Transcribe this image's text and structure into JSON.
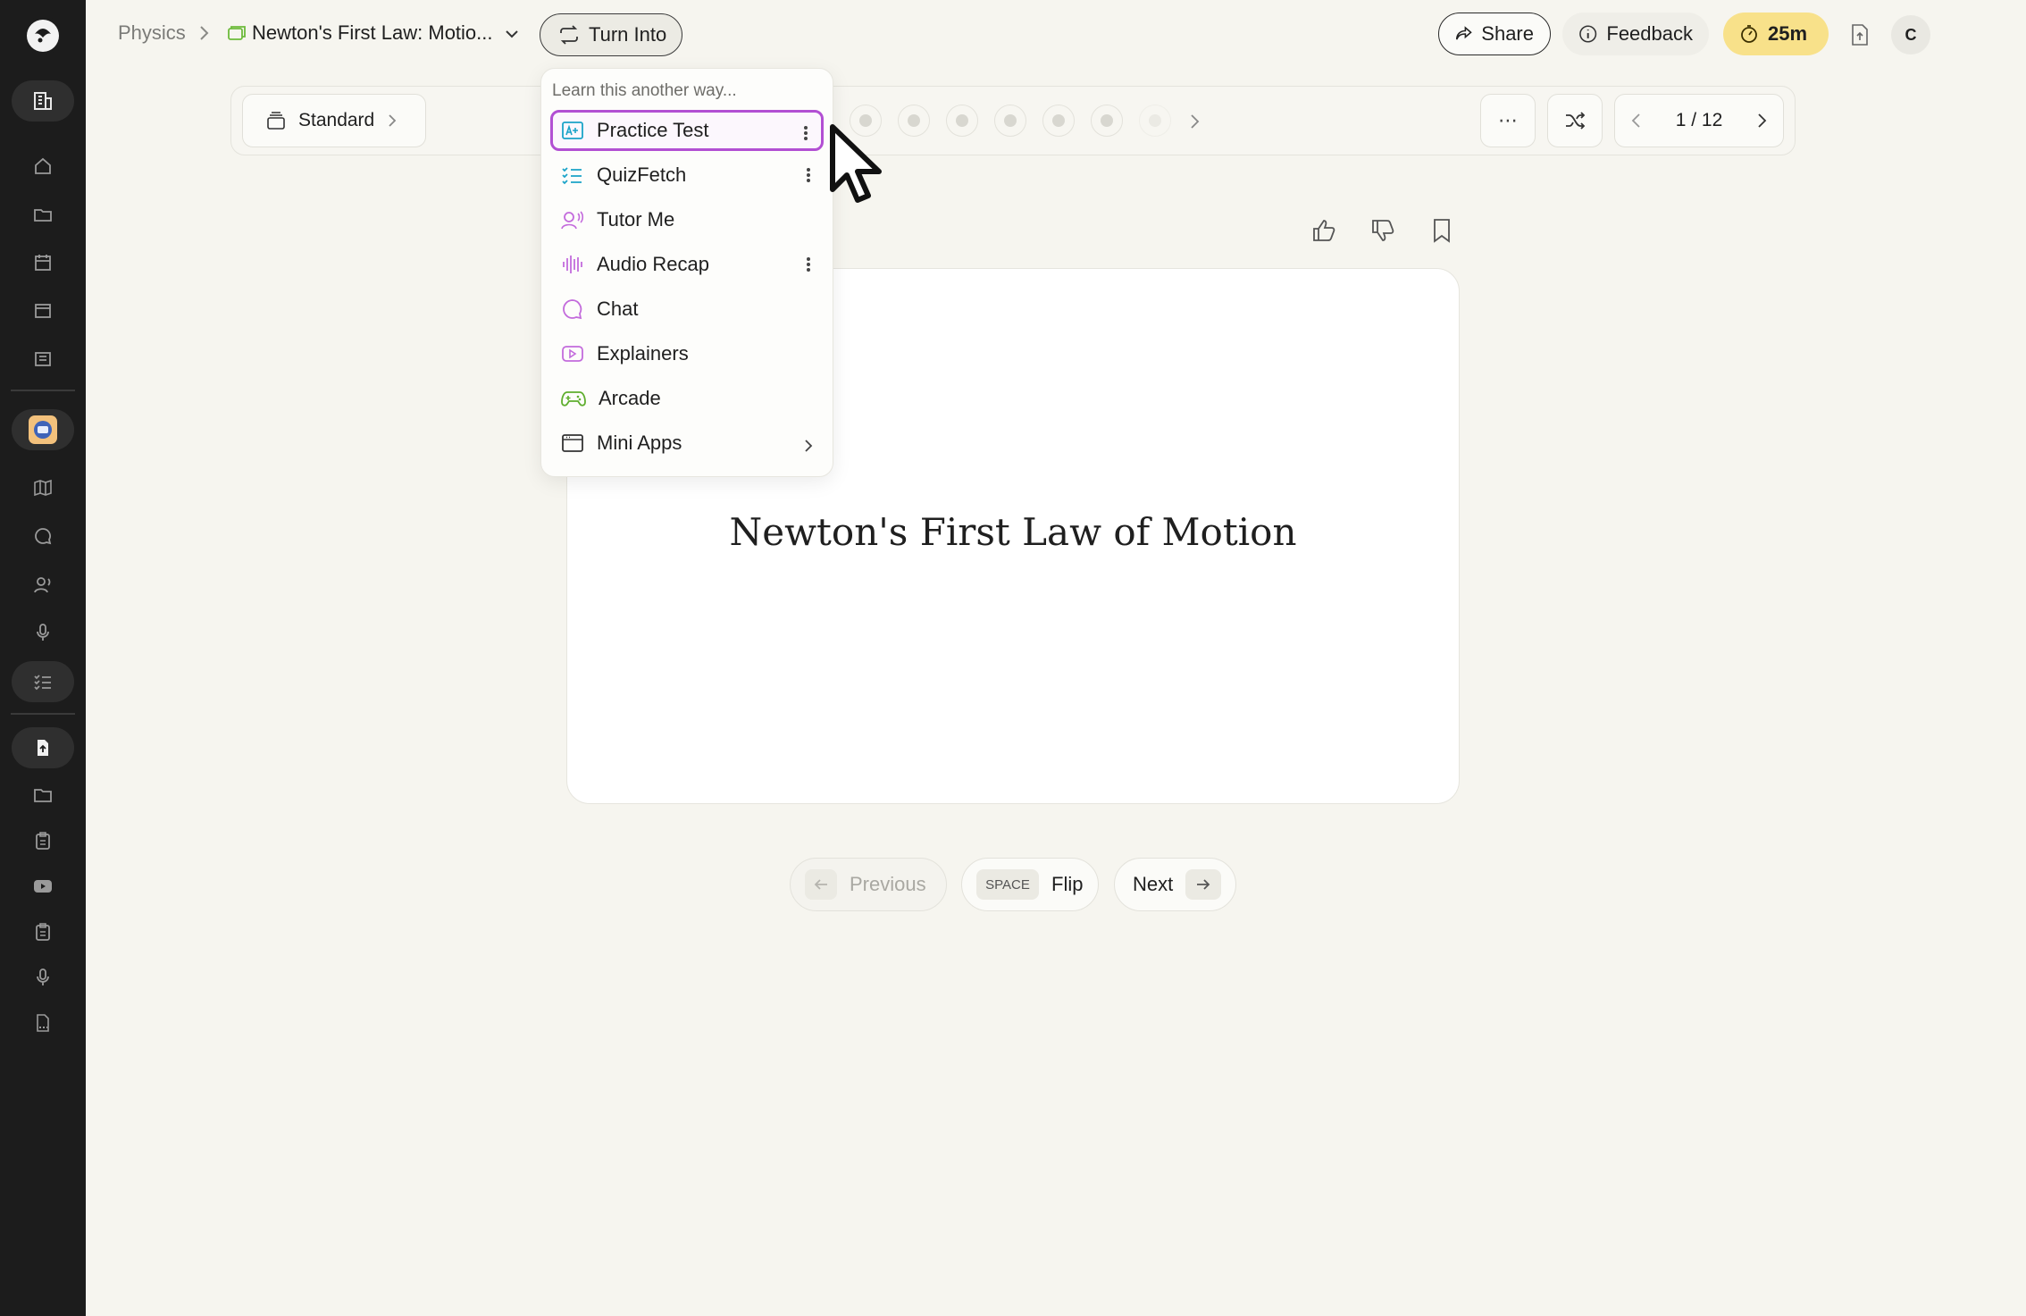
{
  "breadcrumb": {
    "parent": "Physics",
    "title": "Newton's First Law: Motio..."
  },
  "topbar": {
    "turn_into": "Turn Into",
    "share": "Share",
    "feedback": "Feedback",
    "timer": "25m",
    "avatar_initial": "C"
  },
  "toolbar": {
    "mode": "Standard",
    "more": "⋯",
    "pager": "1 / 12"
  },
  "card": {
    "front_text": "Newton's First Law of Motion"
  },
  "nav": {
    "previous": "Previous",
    "flip_key": "SPACE",
    "flip": "Flip",
    "next": "Next"
  },
  "dropdown": {
    "header": "Learn this another way...",
    "items": [
      {
        "label": "Practice Test",
        "icon": "practice-test-icon",
        "color": "#1aa3c8",
        "more": true,
        "active": true
      },
      {
        "label": "QuizFetch",
        "icon": "quiz-list-icon",
        "color": "#1aa3c8",
        "more": true
      },
      {
        "label": "Tutor Me",
        "icon": "tutor-icon",
        "color": "#c36bdc",
        "more": false
      },
      {
        "label": "Audio Recap",
        "icon": "audio-wave-icon",
        "color": "#c36bdc",
        "more": true
      },
      {
        "label": "Chat",
        "icon": "chat-bubble-icon",
        "color": "#c36bdc",
        "more": false
      },
      {
        "label": "Explainers",
        "icon": "video-play-icon",
        "color": "#c36bdc",
        "more": false
      },
      {
        "label": "Arcade",
        "icon": "gamepad-icon",
        "color": "#5fae2e",
        "more": false
      },
      {
        "label": "Mini Apps",
        "icon": "app-window-icon",
        "color": "#333333",
        "submenu": true
      }
    ]
  },
  "colors": {
    "sidebar": "#1c1c1c",
    "background": "#f6f5ef",
    "timer": "#f8e18a",
    "active_border": "#b24fd3"
  }
}
